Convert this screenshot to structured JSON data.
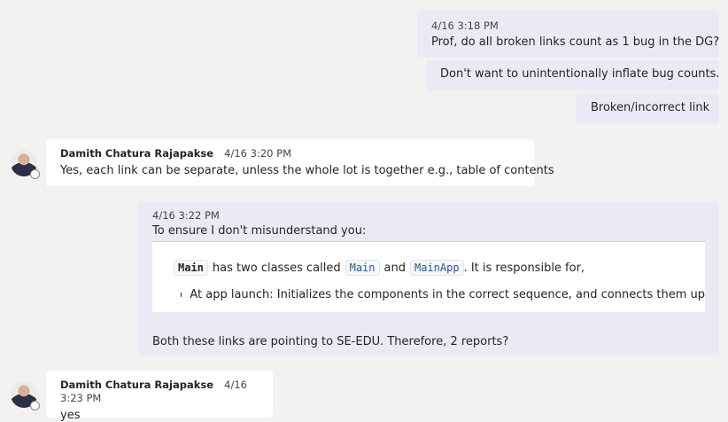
{
  "messages": [
    {
      "timestamp": "4/16 3:18 PM",
      "text": "Prof, do all broken links count as 1 bug in the DG?"
    },
    {
      "text": "Don't want to unintentionally inflate bug counts."
    },
    {
      "text": "Broken/incorrect link"
    },
    {
      "sender": "Damith Chatura Rajapakse",
      "timestamp": "4/16 3:20 PM",
      "text": "Yes, each link can be separate, unless the whole lot is together e.g., table of contents"
    },
    {
      "timestamp": "4/16 3:22 PM",
      "text": "To ensure I don't misunderstand you:",
      "quote": {
        "code_main": "Main",
        "mid1": "has two classes called",
        "code_main2": "Main",
        "and": "and",
        "code_mainapp": "MainApp",
        "end": ". It is responsible for,",
        "bullet": "At app launch: Initializes the components in the correct sequence, and connects them up"
      },
      "tail": "Both these links are pointing to SE-EDU. Therefore, 2 reports?"
    },
    {
      "sender": "Damith Chatura Rajapakse",
      "timestamp": "4/16 3:23 PM",
      "text": "yes"
    }
  ]
}
